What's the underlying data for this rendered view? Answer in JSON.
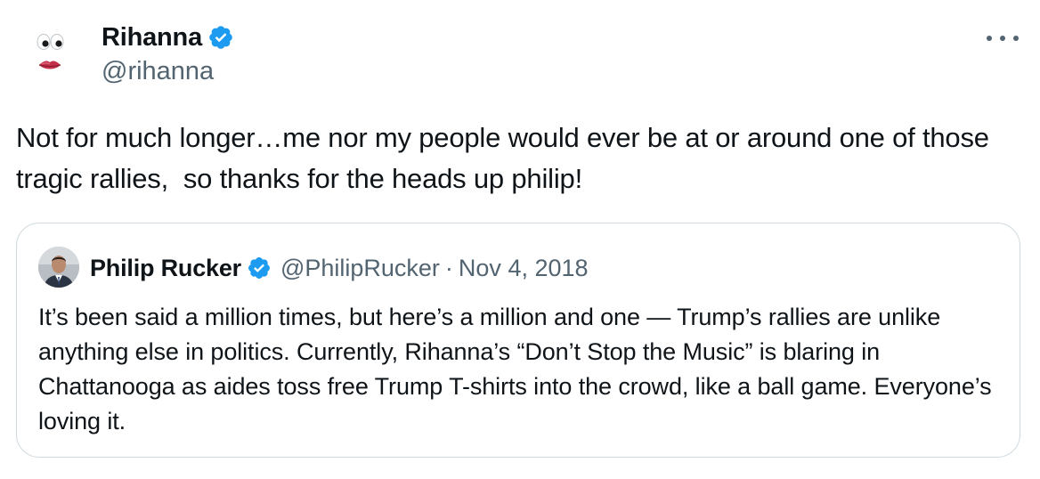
{
  "author": {
    "display_name": "Rihanna",
    "handle": "@rihanna",
    "verified": true,
    "avatar_icon": "eyes-and-lips-emoji-avatar"
  },
  "tweet": {
    "text": "Not for much longer…me nor my people would ever be at or around one of those tragic rallies,  so thanks for the heads up philip!"
  },
  "quoted_tweet": {
    "display_name": "Philip Rucker",
    "handle": "@PhilipRucker",
    "separator": "·",
    "date": "Nov 4, 2018",
    "verified": true,
    "text": "It’s been said a million times, but here’s a million and one — Trump’s rallies are unlike anything else in politics. Currently, Rihanna’s “Don’t Stop the Music” is blaring in Chattanooga as aides toss free Trump T-shirts into the crowd, like a ball game. Everyone’s loving it."
  },
  "colors": {
    "text_primary": "#0f1419",
    "text_secondary": "#536471",
    "verified_blue": "#1d9bf0",
    "border": "#cfd9de"
  },
  "icons": {
    "more": "more-horizontal-icon",
    "verified": "verified-badge-icon"
  }
}
